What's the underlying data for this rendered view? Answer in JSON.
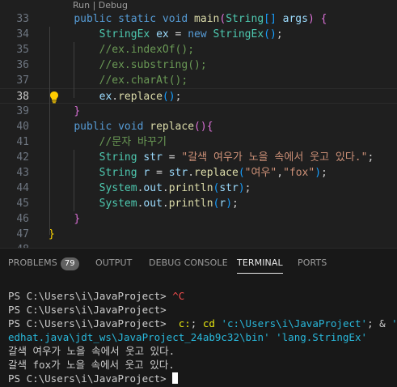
{
  "editor": {
    "codelens": "Run | Debug",
    "current_line": 38,
    "lines": [
      {
        "num": "33",
        "tokens": [
          {
            "t": "    "
          },
          {
            "t": "public",
            "c": "kw"
          },
          {
            "t": " "
          },
          {
            "t": "static",
            "c": "kw"
          },
          {
            "t": " "
          },
          {
            "t": "void",
            "c": "kw"
          },
          {
            "t": " "
          },
          {
            "t": "main",
            "c": "fn"
          },
          {
            "t": "(",
            "c": "b2"
          },
          {
            "t": "String",
            "c": "ty"
          },
          {
            "t": "[]",
            "c": "b3"
          },
          {
            "t": " "
          },
          {
            "t": "args",
            "c": "va"
          },
          {
            "t": ")",
            "c": "b2"
          },
          {
            "t": " "
          },
          {
            "t": "{",
            "c": "b2"
          }
        ]
      },
      {
        "num": "34",
        "tokens": [
          {
            "t": "        "
          },
          {
            "t": "StringEx",
            "c": "ty"
          },
          {
            "t": " "
          },
          {
            "t": "ex",
            "c": "va"
          },
          {
            "t": " = ",
            "c": "op"
          },
          {
            "t": "new",
            "c": "kw"
          },
          {
            "t": " "
          },
          {
            "t": "StringEx",
            "c": "ty"
          },
          {
            "t": "()",
            "c": "b3"
          },
          {
            "t": ";"
          }
        ]
      },
      {
        "num": "35",
        "tokens": [
          {
            "t": "        "
          },
          {
            "t": "//ex.indexOf();",
            "c": "cm"
          }
        ]
      },
      {
        "num": "36",
        "tokens": [
          {
            "t": "        "
          },
          {
            "t": "//ex.substring();",
            "c": "cm"
          }
        ]
      },
      {
        "num": "37",
        "tokens": [
          {
            "t": "        "
          },
          {
            "t": "//ex.charAt();",
            "c": "cm"
          }
        ]
      },
      {
        "num": "38",
        "tokens": [
          {
            "t": "        "
          },
          {
            "t": "ex",
            "c": "va"
          },
          {
            "t": "."
          },
          {
            "t": "replace",
            "c": "fn"
          },
          {
            "t": "()",
            "c": "b3"
          },
          {
            "t": ";"
          }
        ]
      },
      {
        "num": "39",
        "tokens": [
          {
            "t": "    "
          },
          {
            "t": "}",
            "c": "b2"
          }
        ]
      },
      {
        "num": "40",
        "tokens": [
          {
            "t": "    "
          },
          {
            "t": "public",
            "c": "kw"
          },
          {
            "t": " "
          },
          {
            "t": "void",
            "c": "kw"
          },
          {
            "t": " "
          },
          {
            "t": "replace",
            "c": "fn"
          },
          {
            "t": "()",
            "c": "b2"
          },
          {
            "t": "{",
            "c": "b2"
          }
        ]
      },
      {
        "num": "41",
        "tokens": [
          {
            "t": "        "
          },
          {
            "t": "//문자 바꾸기",
            "c": "cm"
          }
        ]
      },
      {
        "num": "42",
        "tokens": [
          {
            "t": "        "
          },
          {
            "t": "String",
            "c": "ty"
          },
          {
            "t": " "
          },
          {
            "t": "str",
            "c": "va"
          },
          {
            "t": " = ",
            "c": "op"
          },
          {
            "t": "\"갈색 여우가 노을 속에서 웃고 있다.\"",
            "c": "st"
          },
          {
            "t": ";"
          }
        ]
      },
      {
        "num": "43",
        "tokens": [
          {
            "t": "        "
          },
          {
            "t": "String",
            "c": "ty"
          },
          {
            "t": " "
          },
          {
            "t": "r",
            "c": "va"
          },
          {
            "t": " = ",
            "c": "op"
          },
          {
            "t": "str",
            "c": "va"
          },
          {
            "t": "."
          },
          {
            "t": "replace",
            "c": "fn"
          },
          {
            "t": "(",
            "c": "b3"
          },
          {
            "t": "\"여우\"",
            "c": "st"
          },
          {
            "t": ","
          },
          {
            "t": "\"fox\"",
            "c": "st"
          },
          {
            "t": ")",
            "c": "b3"
          },
          {
            "t": ";"
          }
        ]
      },
      {
        "num": "44",
        "tokens": [
          {
            "t": "        "
          },
          {
            "t": "System",
            "c": "ty"
          },
          {
            "t": "."
          },
          {
            "t": "out",
            "c": "va"
          },
          {
            "t": "."
          },
          {
            "t": "println",
            "c": "fn"
          },
          {
            "t": "(",
            "c": "b3"
          },
          {
            "t": "str",
            "c": "va"
          },
          {
            "t": ")",
            "c": "b3"
          },
          {
            "t": ";"
          }
        ]
      },
      {
        "num": "45",
        "tokens": [
          {
            "t": "        "
          },
          {
            "t": "System",
            "c": "ty"
          },
          {
            "t": "."
          },
          {
            "t": "out",
            "c": "va"
          },
          {
            "t": "."
          },
          {
            "t": "println",
            "c": "fn"
          },
          {
            "t": "(",
            "c": "b3"
          },
          {
            "t": "r",
            "c": "va"
          },
          {
            "t": ")",
            "c": "b3"
          },
          {
            "t": ";"
          }
        ]
      },
      {
        "num": "46",
        "tokens": [
          {
            "t": "    "
          },
          {
            "t": "}",
            "c": "b2"
          }
        ]
      },
      {
        "num": "47",
        "tokens": [
          {
            "t": "}",
            "c": "b1"
          }
        ]
      },
      {
        "num": "48",
        "tokens": []
      }
    ]
  },
  "panel": {
    "tabs": [
      {
        "label": "PROBLEMS",
        "badge": "79",
        "active": false
      },
      {
        "label": "OUTPUT",
        "active": false
      },
      {
        "label": "DEBUG CONSOLE",
        "active": false
      },
      {
        "label": "TERMINAL",
        "active": true
      },
      {
        "label": "PORTS",
        "active": false
      }
    ],
    "terminal": [
      [
        {
          "t": "PS C:\\Users\\i\\JavaProject> "
        },
        {
          "t": "^C",
          "c": "t-red"
        }
      ],
      [
        {
          "t": "PS C:\\Users\\i\\JavaProject>"
        }
      ],
      [
        {
          "t": "PS C:\\Users\\i\\JavaProject>  "
        },
        {
          "t": "c:",
          "c": "t-yel"
        },
        {
          "t": "; "
        },
        {
          "t": "cd",
          "c": "t-yel"
        },
        {
          "t": " "
        },
        {
          "t": "'c:\\Users\\i\\JavaProject'",
          "c": "t-cyan"
        },
        {
          "t": "; & "
        },
        {
          "t": "'C:\\Pr",
          "c": "t-cyan"
        }
      ],
      [
        {
          "t": "edhat.java\\jdt_ws\\JavaProject_24ab9c32\\bin' 'lang.StringEx'",
          "c": "t-cyan"
        }
      ],
      [
        {
          "t": "갈색 여우가 노을 속에서 웃고 있다."
        }
      ],
      [
        {
          "t": "갈색 fox가 노을 속에서 웃고 있다."
        }
      ],
      [
        {
          "t": "PS C:\\Users\\i\\JavaProject> "
        }
      ]
    ]
  }
}
